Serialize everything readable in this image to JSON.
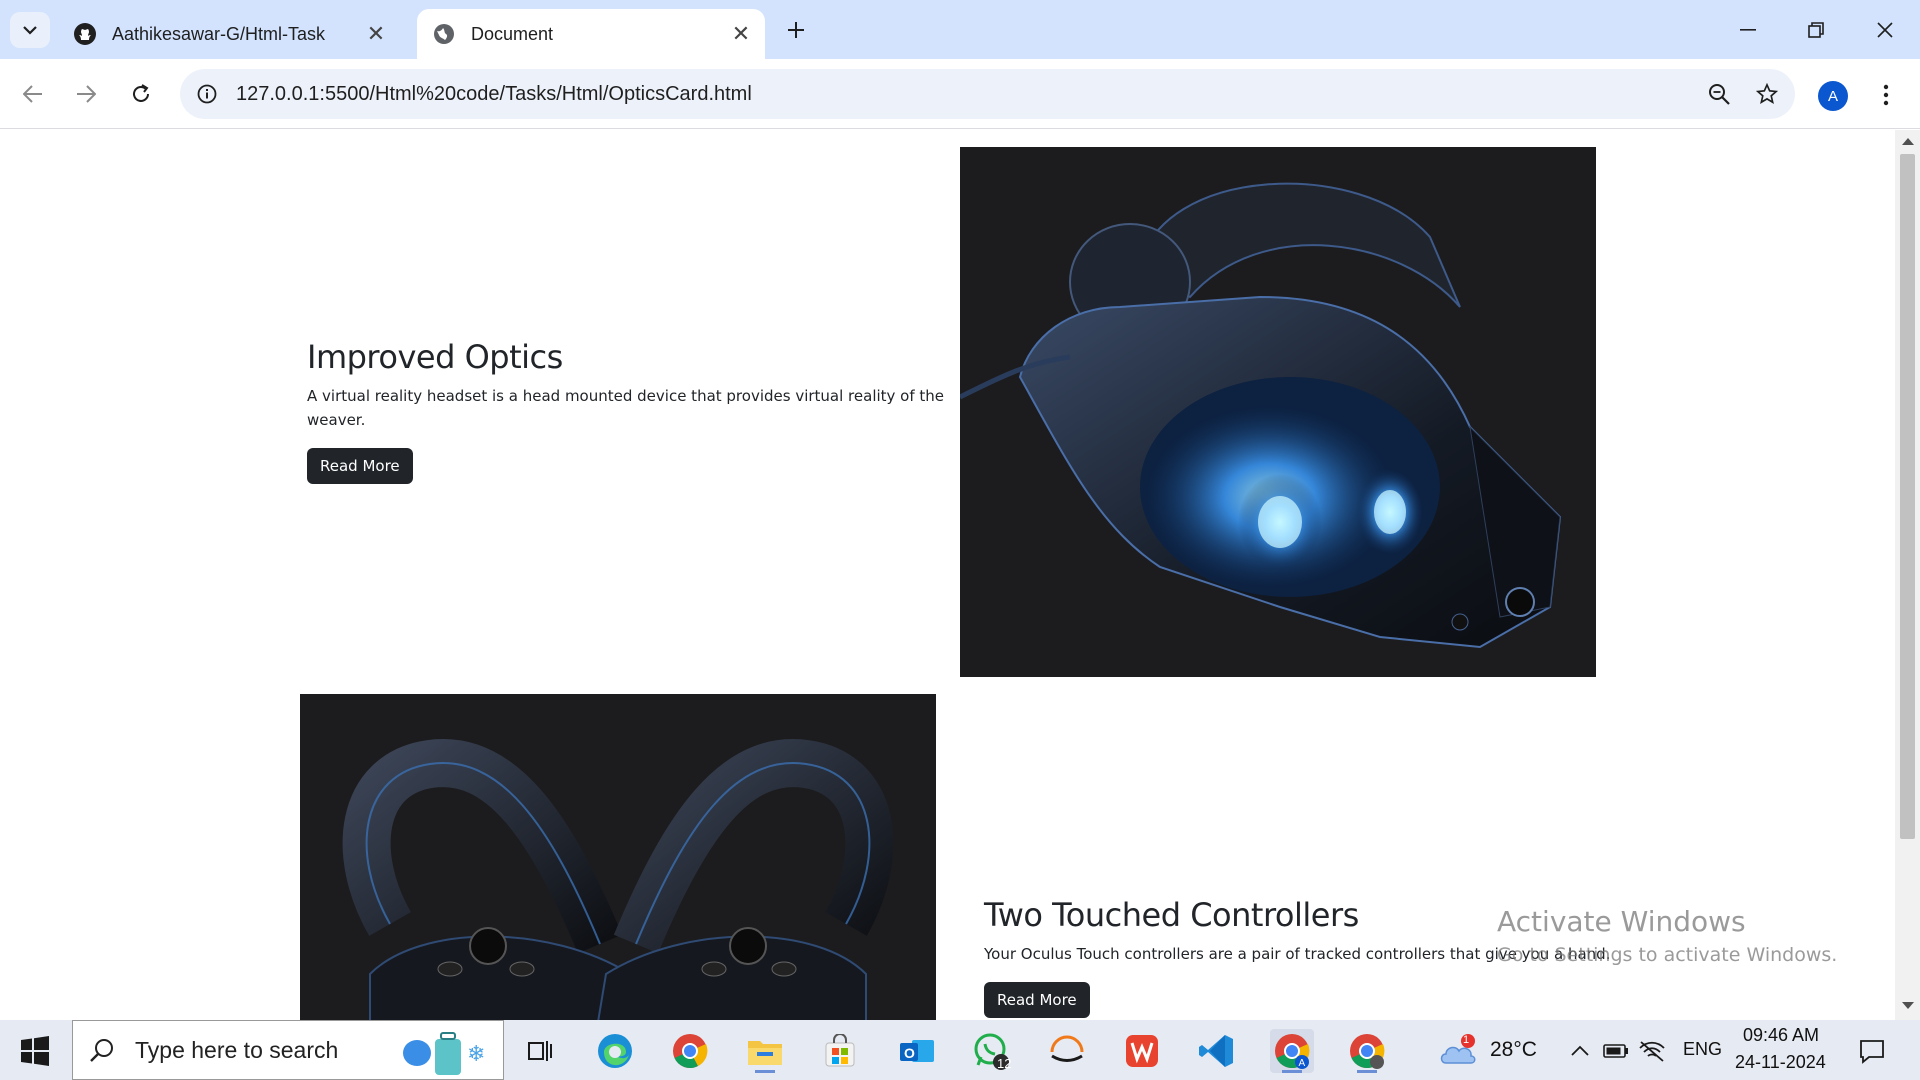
{
  "browser": {
    "tabs": [
      {
        "title": "Aathikesawar-G/Html-Task",
        "active": false,
        "icon": "github-icon"
      },
      {
        "title": "Document",
        "active": true,
        "icon": "globe-icon"
      }
    ],
    "url": "127.0.0.1:5500/Html%20code/Tasks/Html/OpticsCard.html",
    "profile_initial": "A"
  },
  "page": {
    "cards": [
      {
        "title": "Improved Optics",
        "description": "A virtual reality headset is a head mounted device that provides virtual reality of the weaver.",
        "button": "Read More",
        "image": "vr-headset-image"
      },
      {
        "title": "Two Touched Controllers",
        "description": "Your Oculus Touch controllers are a pair of tracked controllers that give you a hand.",
        "button": "Read More",
        "image": "touch-controllers-image"
      }
    ]
  },
  "watermark": {
    "line1": "Activate Windows",
    "line2": "Go to Settings to activate Windows."
  },
  "taskbar": {
    "search_placeholder": "Type here to search",
    "whatsapp_badge": "12",
    "weather_badge": "1",
    "temperature": "28°C",
    "language": "ENG",
    "time": "09:46 AM",
    "date": "24-11-2024"
  },
  "colors": {
    "tabstrip": "#d3e3fd",
    "button_dark": "#212529",
    "image_bg": "#1c1c1e",
    "accent_blue": "#0b57d0"
  }
}
